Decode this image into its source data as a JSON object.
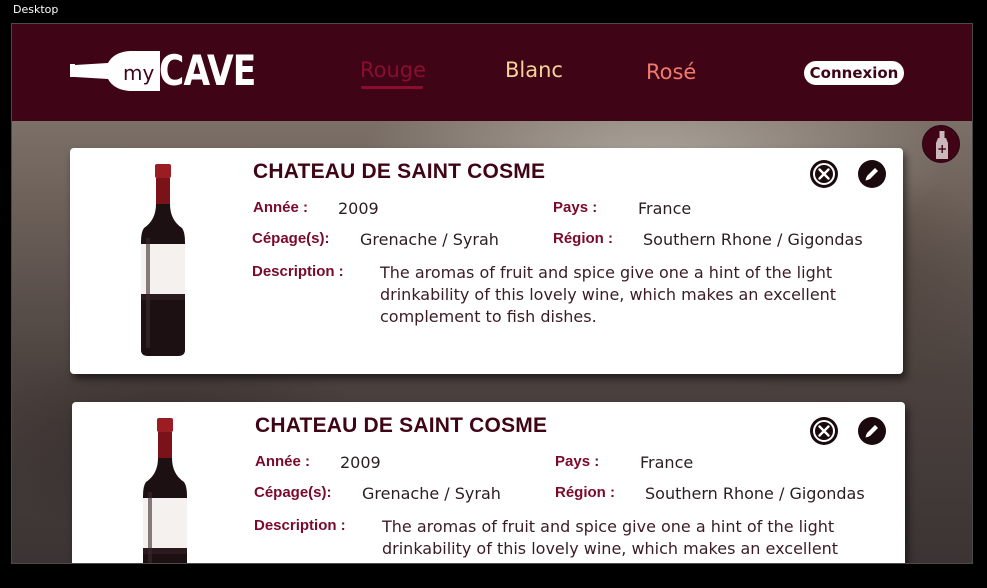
{
  "frame": {
    "label": "Desktop"
  },
  "header": {
    "logo": {
      "prefix": "my",
      "name": "CAVE"
    },
    "nav": [
      {
        "label": "Rouge",
        "active": true
      },
      {
        "label": "Blanc",
        "active": false
      },
      {
        "label": "Rosé",
        "active": false
      }
    ],
    "login_label": "Connexion"
  },
  "colors": {
    "header_bg": "#3f0516",
    "accent": "#7a0a2b",
    "blanc": "#f3d39a",
    "rose": "#f07a6e"
  },
  "add_wine_icon": "wine-bottle-plus-icon",
  "labels": {
    "year": "Année :",
    "country": "Pays :",
    "grapes": "Cépage(s):",
    "region": "Région :",
    "description": "Description :"
  },
  "wines": [
    {
      "name": "CHATEAU DE SAINT COSME",
      "year": "2009",
      "country": "France",
      "grapes": "Grenache / Syrah",
      "region": "Southern Rhone / Gigondas",
      "description": "The aromas of fruit and spice give one a hint of the light drinkability of this lovely wine, which makes an excellent complement to fish dishes."
    },
    {
      "name": "CHATEAU DE SAINT COSME",
      "year": "2009",
      "country": "France",
      "grapes": "Grenache / Syrah",
      "region": "Southern Rhone / Gigondas",
      "description": "The aromas of fruit and spice give one a hint of the light drinkability of this lovely wine, which makes an excellent complement to fish dishes."
    }
  ]
}
